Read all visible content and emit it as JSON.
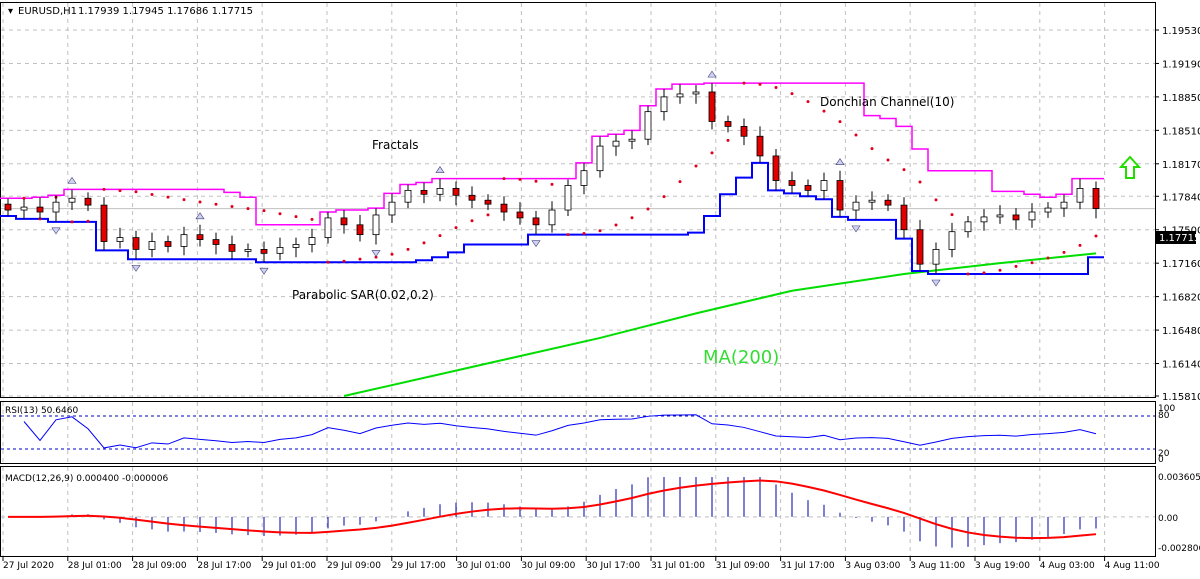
{
  "header": {
    "symbol": "EURUSD,H1",
    "ohlc": "1.17939 1.17945 1.17686 1.17715"
  },
  "annotations": {
    "fractals": "Fractals",
    "donchian": "Donchian Channel(10)",
    "sar": "Parabolic SAR(0.02,0.2)",
    "ma": "MA(200)"
  },
  "signal_icon": "green-up-arrow-icon",
  "current_price": "1.17715",
  "rsi": {
    "label": "RSI(13) 50.6460",
    "levels": [
      "100",
      "80",
      "20",
      "0"
    ]
  },
  "macd": {
    "label": "MACD(12,26,9) 0.000400 -0.000006",
    "ticks": [
      "0.003605",
      "0.00",
      "-0.002806"
    ]
  },
  "colors": {
    "bull": "#ffffff",
    "bear": "#e00000",
    "donchian_upper": "#ff00ff",
    "donchian_lower": "#0000ff",
    "sar": "#e00020",
    "ma": "#00dd00",
    "rsi": "#0000ff",
    "macd_signal": "#ff0000",
    "macd_hist": "#0000a0"
  },
  "chart_data": {
    "type": "candlestick",
    "symbol": "EURUSD",
    "timeframe": "H1",
    "y_ticks": [
      "1.19530",
      "1.19190",
      "1.18850",
      "1.18510",
      "1.18170",
      "1.17840",
      "1.17500",
      "1.17160",
      "1.16820",
      "1.16480",
      "1.16140",
      "1.15810"
    ],
    "ylim": [
      1.1581,
      1.1953
    ],
    "x_ticks": [
      "27 Jul 2020",
      "28 Jul 01:00",
      "28 Jul 09:00",
      "28 Jul 17:00",
      "29 Jul 01:00",
      "29 Jul 09:00",
      "29 Jul 17:00",
      "30 Jul 01:00",
      "30 Jul 09:00",
      "30 Jul 17:00",
      "31 Jul 01:00",
      "31 Jul 09:00",
      "31 Jul 17:00",
      "3 Aug 03:00",
      "3 Aug 11:00",
      "3 Aug 19:00",
      "4 Aug 03:00",
      "4 Aug 11:00"
    ],
    "grid": true,
    "first_open": 1.1776,
    "closes": [
      1.177,
      1.1773,
      1.1768,
      1.1778,
      1.1782,
      1.1775,
      1.1738,
      1.1742,
      1.173,
      1.1738,
      1.1733,
      1.1745,
      1.174,
      1.1735,
      1.1728,
      1.173,
      1.1726,
      1.1732,
      1.1735,
      1.1742,
      1.1762,
      1.1755,
      1.1745,
      1.1765,
      1.1778,
      1.179,
      1.1786,
      1.1792,
      1.1785,
      1.178,
      1.1776,
      1.1768,
      1.1762,
      1.1755,
      1.177,
      1.1795,
      1.181,
      1.1835,
      1.184,
      1.1842,
      1.187,
      1.1885,
      1.1888,
      1.189,
      1.186,
      1.1855,
      1.1845,
      1.1825,
      1.18,
      1.1795,
      1.179,
      1.18,
      1.177,
      1.1778,
      1.178,
      1.1775,
      1.175,
      1.1715,
      1.173,
      1.1748,
      1.1758,
      1.1763,
      1.1765,
      1.176,
      1.1768,
      1.1772,
      1.1778,
      1.1792,
      1.17715
    ],
    "ma200": {
      "index": [
        21,
        37,
        43,
        49,
        56,
        62,
        68
      ],
      "values": [
        1.1581,
        1.164,
        1.1665,
        1.1688,
        1.1705,
        1.1716,
        1.1726
      ]
    }
  }
}
